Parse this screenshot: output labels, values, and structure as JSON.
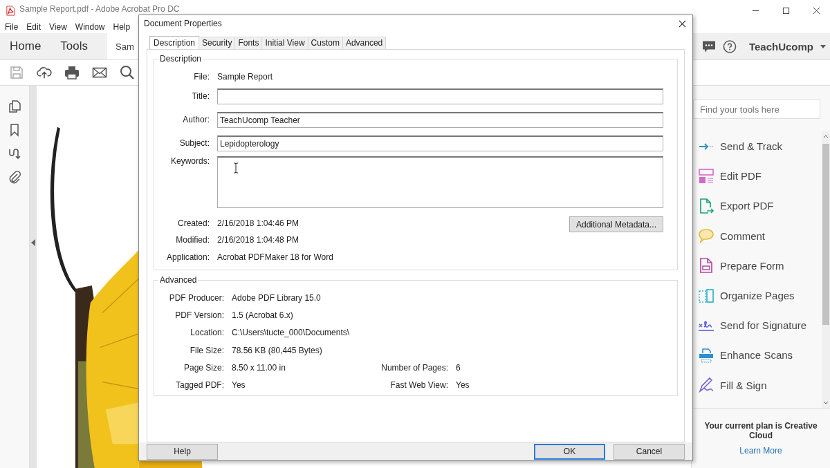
{
  "app": {
    "title": "Sample Report.pdf - Adobe Acrobat Pro DC",
    "menu": [
      "File",
      "Edit",
      "View",
      "Window",
      "Help"
    ],
    "nav": [
      {
        "label": "Home",
        "selected": false
      },
      {
        "label": "Tools",
        "selected": false
      }
    ],
    "document_tab": "Sam",
    "account": "TeachUcomp",
    "tools_search": {
      "placeholder": "Find your tools here"
    },
    "tools": [
      {
        "kind": "send",
        "label": "Send & Track"
      },
      {
        "kind": "edit",
        "label": "Edit PDF"
      },
      {
        "kind": "export",
        "label": "Export PDF"
      },
      {
        "kind": "comment",
        "label": "Comment"
      },
      {
        "kind": "form",
        "label": "Prepare Form"
      },
      {
        "kind": "organize",
        "label": "Organize Pages"
      },
      {
        "kind": "signature",
        "label": "Send for Signature"
      },
      {
        "kind": "scan",
        "label": "Enhance Scans"
      },
      {
        "kind": "fill",
        "label": "Fill & Sign"
      }
    ],
    "plan": "Your current plan is Creative Cloud",
    "learn_more": "Learn More"
  },
  "dialog": {
    "title": "Document Properties",
    "tabs": [
      {
        "label": "Description",
        "selected": true
      },
      {
        "label": "Security",
        "selected": false
      },
      {
        "label": "Fonts",
        "selected": false
      },
      {
        "label": "Initial View",
        "selected": false
      },
      {
        "label": "Custom",
        "selected": false
      },
      {
        "label": "Advanced",
        "selected": false
      }
    ],
    "description": {
      "legend": "Description",
      "file_label": "File:",
      "file": "Sample Report",
      "fields": [
        {
          "kind": "line",
          "label": "Title:"
        },
        {
          "kind": "line",
          "label": "Author:",
          "value": "TeachUcomp Teacher"
        },
        {
          "kind": "line",
          "label": "Subject:",
          "value": "Lepidopterology"
        },
        {
          "kind": "multiline",
          "label": "Keywords:"
        }
      ],
      "info": [
        {
          "label": "Created:",
          "value": "2/16/2018 1:04:46 PM"
        },
        {
          "label": "Modified:",
          "value": "2/16/2018 1:04:48 PM"
        },
        {
          "label": "Application:",
          "value": "Acrobat PDFMaker 18 for Word"
        }
      ],
      "metadata_button": "Additional Metadata..."
    },
    "advanced": {
      "legend": "Advanced",
      "rows": [
        [
          {
            "label": "PDF Producer:",
            "value": "Adobe PDF Library 15.0"
          }
        ],
        [
          {
            "label": "PDF Version:",
            "value": "1.5 (Acrobat 6.x)"
          }
        ],
        [
          {
            "label": "Location:",
            "value": "C:\\Users\\tucte_000\\Documents\\"
          }
        ],
        [
          {
            "label": "File Size:",
            "value": "78.56 KB (80,445 Bytes)"
          }
        ],
        [
          {
            "label": "Page Size:",
            "value": "8.50 x 11.00 in"
          },
          {
            "label": "Number of Pages:",
            "value": "6"
          }
        ],
        [
          {
            "label": "Tagged PDF:",
            "value": "Yes"
          },
          {
            "label": "Fast Web View:",
            "value": "Yes"
          }
        ]
      ]
    },
    "buttons": [
      {
        "label": "Help",
        "default": false
      },
      {
        "label": "OK",
        "default": true
      },
      {
        "label": "Cancel",
        "default": false
      }
    ]
  }
}
